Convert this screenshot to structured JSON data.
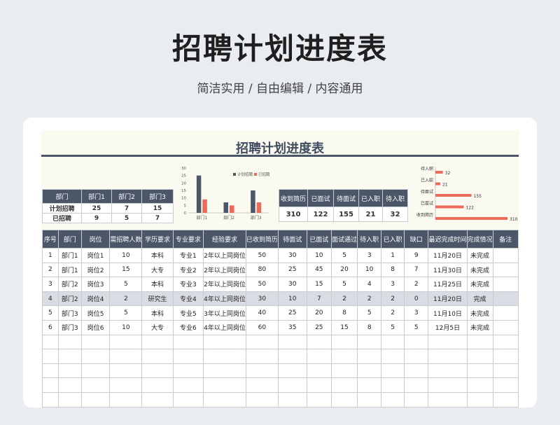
{
  "hero": {
    "title": "招聘计划进度表",
    "subtitle": "简洁实用 / 自由编辑 / 内容通用"
  },
  "sheet": {
    "title": "招聘计划进度表"
  },
  "summary": {
    "headers": [
      "部门",
      "部门1",
      "部门2",
      "部门3"
    ],
    "rows": [
      [
        "计划招聘",
        "25",
        "7",
        "15"
      ],
      [
        "已招聘",
        "9",
        "5",
        "7"
      ]
    ]
  },
  "stats": {
    "headers": [
      "收到简历",
      "已面试",
      "待面试",
      "已入职",
      "待入职"
    ],
    "values": [
      "310",
      "122",
      "155",
      "21",
      "32"
    ]
  },
  "chart_data": [
    {
      "type": "bar",
      "categories": [
        "部门1",
        "部门2",
        "部门3"
      ],
      "series": [
        {
          "name": "计划招聘",
          "values": [
            25,
            7,
            15
          ]
        },
        {
          "name": "已招聘",
          "values": [
            9,
            5,
            7
          ]
        }
      ],
      "yticks": [
        "0",
        "5",
        "10",
        "15",
        "20",
        "25",
        "30"
      ],
      "ylim": [
        0,
        30
      ],
      "legend": "top-right",
      "colors": [
        "#4b5668",
        "#ec6a5a"
      ]
    },
    {
      "type": "bar",
      "orientation": "horizontal",
      "categories": [
        "待入职",
        "已入职",
        "待面试",
        "已面试",
        "收到简历"
      ],
      "values": [
        32,
        21,
        155,
        122,
        310
      ],
      "labels": [
        "32",
        "21",
        "155",
        "122",
        "310"
      ],
      "xlim": [
        0,
        310
      ],
      "color": "#ec6a5a"
    }
  ],
  "main": {
    "headers": [
      "序号",
      "部门",
      "岗位",
      "需招聘人数",
      "学历要求",
      "专业要求",
      "经验要求",
      "已收到简历",
      "待面试",
      "已面试",
      "面试通过",
      "待入职",
      "已入职",
      "缺口",
      "最迟完成时间",
      "完成情况",
      "备注"
    ],
    "rows": [
      [
        "1",
        "部门1",
        "岗位1",
        "10",
        "本科",
        "专业1",
        "2年以上同岗位",
        "50",
        "30",
        "10",
        "5",
        "3",
        "1",
        "9",
        "11月20日",
        "未完成",
        ""
      ],
      [
        "2",
        "部门1",
        "岗位2",
        "15",
        "大专",
        "专业2",
        "2年以上同岗位",
        "80",
        "25",
        "45",
        "20",
        "10",
        "8",
        "7",
        "11月30日",
        "未完成",
        ""
      ],
      [
        "3",
        "部门2",
        "岗位3",
        "5",
        "本科",
        "专业3",
        "2年以上同岗位",
        "50",
        "30",
        "15",
        "5",
        "4",
        "3",
        "2",
        "11月25日",
        "未完成",
        ""
      ],
      [
        "4",
        "部门2",
        "岗位4",
        "2",
        "研究生",
        "专业4",
        "4年以上同岗位",
        "30",
        "10",
        "7",
        "2",
        "2",
        "2",
        "0",
        "11月20日",
        "完成",
        ""
      ],
      [
        "5",
        "部门3",
        "岗位5",
        "5",
        "本科",
        "专业5",
        "3年以上同岗位",
        "40",
        "25",
        "20",
        "8",
        "5",
        "2",
        "3",
        "11月10日",
        "未完成",
        ""
      ],
      [
        "6",
        "部门3",
        "岗位6",
        "10",
        "大专",
        "专业6",
        "4年以上同岗位",
        "60",
        "35",
        "25",
        "15",
        "8",
        "5",
        "5",
        "12月5日",
        "未完成",
        ""
      ]
    ],
    "highlight_row": 3,
    "empty_rows": 5
  }
}
